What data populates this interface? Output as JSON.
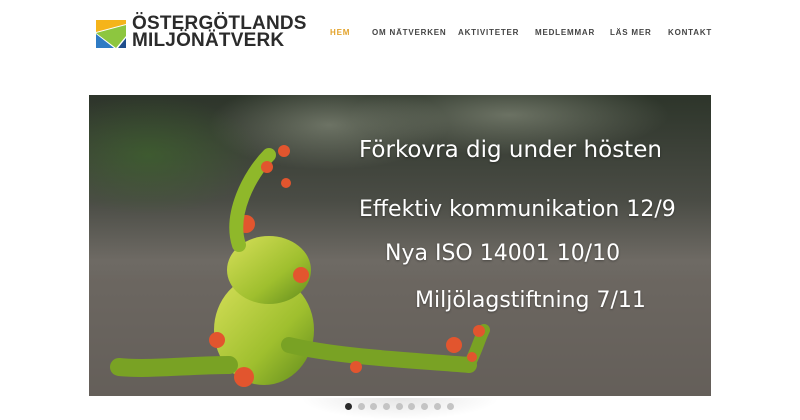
{
  "brand": {
    "line1": "ÖSTERGÖTLANDS",
    "line2": "MILJÖNÄTVERK",
    "colors": [
      "#f5b41a",
      "#8dc63f",
      "#2e7bc4",
      "#1f4e8c"
    ]
  },
  "nav": {
    "items": [
      {
        "label": "HEM",
        "active": true
      },
      {
        "label": "OM NÄTVERKEN",
        "active": false
      },
      {
        "label": "AKTIVITETER",
        "active": false
      },
      {
        "label": "MEDLEMMAR",
        "active": false
      },
      {
        "label": "LÄS MER",
        "active": false
      },
      {
        "label": "KONTAKT",
        "active": false
      }
    ],
    "active_color": "#e3a32b",
    "color": "#444444"
  },
  "slider": {
    "headline": "Förkovra dig under hösten",
    "events": [
      "Effektiv kommunikation  12/9",
      "Nya ISO 14001  10/10",
      "Miljölagstiftning  7/11"
    ],
    "image": "frog-figurine-stretching",
    "slide_count": 9,
    "active_slide": 1
  }
}
